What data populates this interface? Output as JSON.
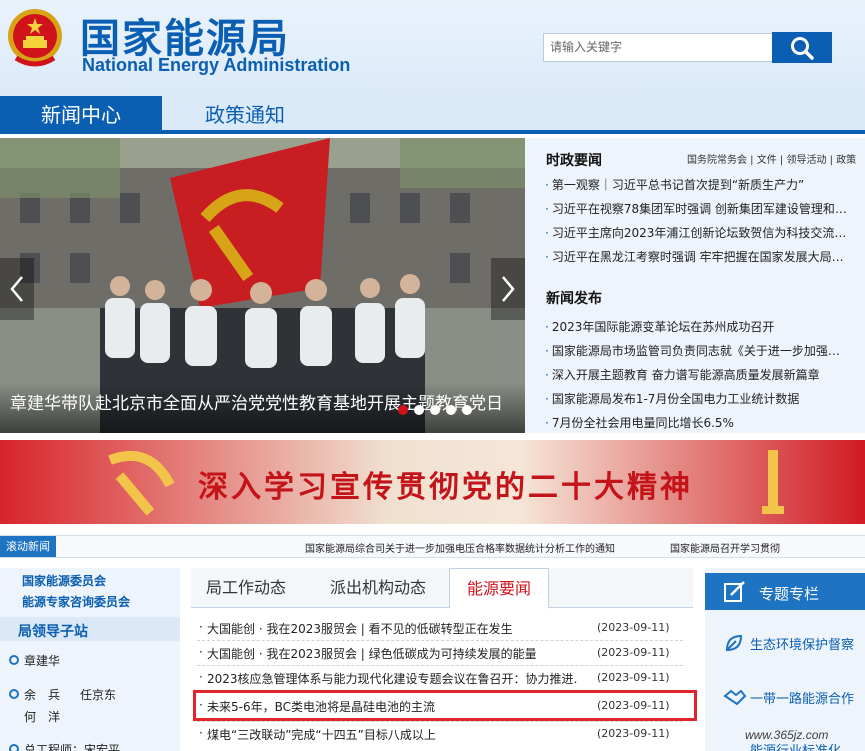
{
  "header": {
    "title_cn": "国家能源局",
    "title_en": "National Energy Administration",
    "search_placeholder": "请输入关键字"
  },
  "tabs": [
    {
      "label": "新闻中心",
      "active": true
    },
    {
      "label": "政策通知",
      "active": false
    }
  ],
  "carousel": {
    "caption": "章建华带队赴北京市全面从严治党党性教育基地开展主题教育党日",
    "dot_count": 5,
    "active_dot": 1
  },
  "politics": {
    "title": "时政要闻",
    "links": "国务院常务会 | 文件 | 领导活动 | 政策",
    "items": [
      "第一观察｜习近平总书记首次提到“新质生产力”",
      "习近平在视察78集团军时强调 创新集团军建设管理和…",
      "习近平主席向2023年浦江创新论坛致贺信为科技交流…",
      "习近平在黑龙江考察时强调 牢牢把握在国家发展大局…"
    ]
  },
  "press": {
    "title": "新闻发布",
    "items": [
      "2023年国际能源变革论坛在苏州成功召开",
      "国家能源局市场监管司负责同志就《关于进一步加强…",
      "深入开展主题教育 奋力谱写能源高质量发展新篇章",
      "国家能源局发布1-7月份全国电力工业统计数据",
      "7月份全社会用电量同比增长6.5%"
    ]
  },
  "banner": {
    "text": "深入学习宣传贯彻党的二十大精神"
  },
  "scroll_news": {
    "label": "滚动新闻",
    "items": [
      "国家能源局综合司关于进一步加强电压合格率数据统计分析工作的通知",
      "国家能源局召开学习贯彻"
    ]
  },
  "sidebar": {
    "links": [
      "国家能源委员会",
      "能源专家咨询委员会"
    ],
    "leaders_title": "局领导子站",
    "leaders": [
      "章建华",
      "余　兵",
      "任京东",
      "何　洋"
    ],
    "partial": "总工程师：宋宏平"
  },
  "center": {
    "tabs": [
      "局工作动态",
      "派出机构动态",
      "能源要闻"
    ],
    "active_tab": 2,
    "rows": [
      {
        "title": "大国能创 · 我在2023服贸会 | 看不见的低碳转型正在发生",
        "date": "(2023-09-11)"
      },
      {
        "title": "大国能创 · 我在2023服贸会 | 绿色低碳成为可持续发展的能量",
        "date": "(2023-09-11)"
      },
      {
        "title": "2023核应急管理体系与能力现代化建设专题会议在鲁召开：协力推进…",
        "date": "(2023-09-11)"
      },
      {
        "title": "未来5-6年，BC类电池将是晶硅电池的主流",
        "date": "(2023-09-11)"
      },
      {
        "title": "煤电“三改联动”完成“十四五”目标八成以上",
        "date": "(2023-09-11)"
      }
    ]
  },
  "special": {
    "title": "专题专栏",
    "items": [
      "生态环境保护督察",
      "一带一路能源合作",
      "能源行业标准化"
    ]
  },
  "watermark": "www.365jz.com",
  "colors": {
    "brand_blue": "#0b5fb2",
    "accent_red": "#d0121b"
  }
}
